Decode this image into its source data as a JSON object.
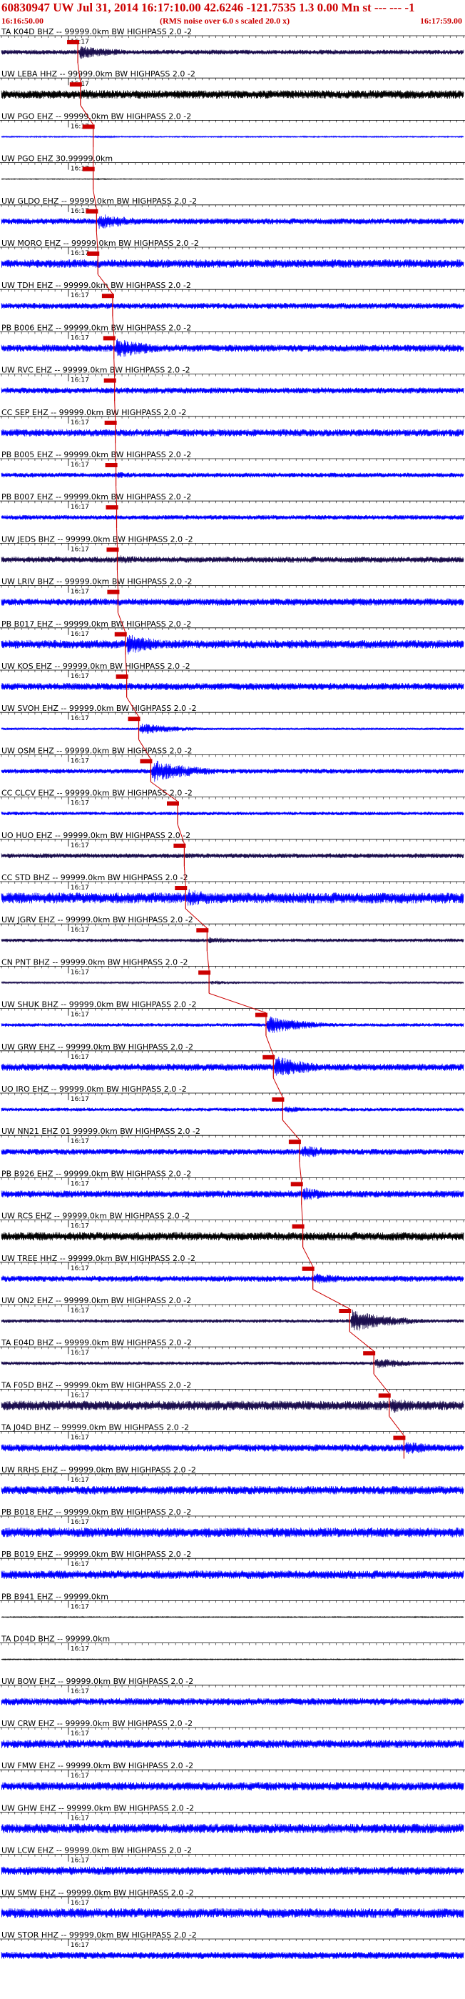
{
  "header": {
    "title": "60830947 UW Jul 31, 2014 16:17:10.00   42.6246 -121.7535  1.3 0.00 Mn st --- --- -1",
    "start_time": "16:16:50.00",
    "note": "(RMS noise over 6.0 s scaled 20.0 x)",
    "end_time": "16:17:59.00"
  },
  "chart_data": {
    "type": "line",
    "title": "60830947 UW Jul 31, 2014 16:17:10.00   42.6246 -121.7535  1.3 0.00 Mn st --- --- -1",
    "x_start": "16:16:50.00",
    "x_end": "16:17:59.00",
    "x_range_s": [
      0,
      69
    ],
    "minute_tick": "16:17",
    "minute_tick_s": 10,
    "pick_marker_color": "#cc0000",
    "colors": {
      "blue": "#0000ff",
      "black": "#000000",
      "navy": "#1a0d4d",
      "red": "#cc0000"
    },
    "traces": [
      {
        "label": "TA K04D BHZ -- 99999.0km BW  HIGHPASS  2.0 -2",
        "color": "navy",
        "pick_s": 11.4,
        "event_s": 11.4,
        "amp": 0.9,
        "burst": 0.6,
        "noise": 0.2
      },
      {
        "label": "UW LEBA HHZ -- 99999.0km BW  HIGHPASS  2.0 -2",
        "color": "black",
        "pick_s": 11.8,
        "event_s": 11.8,
        "amp": 0.8,
        "burst": 0.5,
        "noise": 0.35
      },
      {
        "label": "UW PGO EHZ -- 99999.0km BW  HIGHPASS  2.0 -2",
        "color": "blue",
        "pick_s": 13.7,
        "event_s": 13.7,
        "amp": 0.15,
        "burst": 0.1,
        "noise": 0.05
      },
      {
        "label": "UW PGO EHZ 30.99999.0km",
        "color": "black",
        "pick_s": 13.7,
        "event_s": 13.7,
        "amp": 0.05,
        "burst": 0.05,
        "noise": 0.03
      },
      {
        "label": "UW GLDO EHZ -- 99999.0km BW  HIGHPASS  2.0 -2",
        "color": "blue",
        "pick_s": 14.2,
        "event_s": 14.2,
        "amp": 0.8,
        "burst": 0.7,
        "noise": 0.25
      },
      {
        "label": "UW MORO EHZ -- 99999.0km BW  HIGHPASS  2.0 -2",
        "color": "blue",
        "pick_s": 14.4,
        "event_s": 14.4,
        "amp": 0.8,
        "burst": 0.3,
        "noise": 0.35
      },
      {
        "label": "UW TDH EHZ -- 99999.0km BW  HIGHPASS  2.0 -2",
        "color": "blue",
        "pick_s": 16.6,
        "event_s": 16.6,
        "amp": 0.7,
        "burst": 0.2,
        "noise": 0.25
      },
      {
        "label": "PB B006 EHZ -- 99999.0km BW  HIGHPASS  2.0 -2",
        "color": "blue",
        "pick_s": 16.8,
        "event_s": 16.8,
        "amp": 0.9,
        "burst": 0.9,
        "noise": 0.3
      },
      {
        "label": "UW RVC EHZ -- 99999.0km BW  HIGHPASS  2.0 -2",
        "color": "blue",
        "pick_s": 16.9,
        "event_s": 16.9,
        "amp": 0.6,
        "burst": 0.3,
        "noise": 0.25
      },
      {
        "label": "CC SEP EHZ -- 99999.0km BW  HIGHPASS  2.0 -2",
        "color": "blue",
        "pick_s": 17.0,
        "event_s": 17.0,
        "amp": 0.6,
        "burst": 0.3,
        "noise": 0.3
      },
      {
        "label": "PB B005 EHZ -- 99999.0km BW  HIGHPASS  2.0 -2",
        "color": "blue",
        "pick_s": 17.1,
        "event_s": 17.1,
        "amp": 0.5,
        "burst": 0.3,
        "noise": 0.2
      },
      {
        "label": "PB B007 EHZ -- 99999.0km BW  HIGHPASS  2.0 -2",
        "color": "blue",
        "pick_s": 17.2,
        "event_s": 17.2,
        "amp": 0.4,
        "burst": 0.2,
        "noise": 0.2
      },
      {
        "label": "UW JEDS BHZ -- 99999.0km BW  HIGHPASS  2.0 -2",
        "color": "navy",
        "pick_s": 17.3,
        "event_s": 17.3,
        "amp": 0.6,
        "burst": 0.4,
        "noise": 0.25
      },
      {
        "label": "UW LRIV BHZ -- 99999.0km BW  HIGHPASS  2.0 -2",
        "color": "blue",
        "pick_s": 17.4,
        "event_s": 17.4,
        "amp": 0.6,
        "burst": 0.3,
        "noise": 0.3
      },
      {
        "label": "PB B017 EHZ -- 99999.0km BW  HIGHPASS  2.0 -2",
        "color": "blue",
        "pick_s": 18.5,
        "event_s": 18.5,
        "amp": 0.9,
        "burst": 0.9,
        "noise": 0.35
      },
      {
        "label": "UW KOS EHZ -- 99999.0km BW  HIGHPASS  2.0 -2",
        "color": "blue",
        "pick_s": 18.7,
        "event_s": 18.7,
        "amp": 0.5,
        "burst": 0.3,
        "noise": 0.3
      },
      {
        "label": "UW SVOH EHZ -- 99999.0km BW  HIGHPASS  2.0 -2",
        "color": "blue",
        "pick_s": 20.5,
        "event_s": 20.5,
        "amp": 0.5,
        "burst": 0.5,
        "noise": 0.1
      },
      {
        "label": "UW OSM EHZ -- 99999.0km BW  HIGHPASS  2.0 -2",
        "color": "blue",
        "pick_s": 22.3,
        "event_s": 22.3,
        "amp": 1.0,
        "burst": 1.0,
        "noise": 0.2
      },
      {
        "label": "CC CLCV EHZ -- 99999.0km BW  HIGHPASS  2.0 -2",
        "color": "blue",
        "pick_s": 26.3,
        "event_s": 26.3,
        "amp": 0.4,
        "burst": 0.2,
        "noise": 0.15
      },
      {
        "label": "UO HUO EHZ -- 99999.0km BW  HIGHPASS  2.0 -2",
        "color": "navy",
        "pick_s": 27.3,
        "event_s": 27.3,
        "amp": 0.4,
        "burst": 0.25,
        "noise": 0.2
      },
      {
        "label": "CC STD BHZ -- 99999.0km BW  HIGHPASS  2.0 -2",
        "color": "blue",
        "pick_s": 27.5,
        "event_s": 27.5,
        "amp": 0.8,
        "burst": 0.8,
        "noise": 0.45
      },
      {
        "label": "UW JGRV EHZ -- 99999.0km BW  HIGHPASS  2.0 -2",
        "color": "navy",
        "pick_s": 30.7,
        "event_s": 30.7,
        "amp": 0.5,
        "burst": 0.3,
        "noise": 0.15
      },
      {
        "label": "CN PNT BHZ -- 99999.0km BW  HIGHPASS  2.0 -2",
        "color": "navy",
        "pick_s": 31.0,
        "event_s": 31.0,
        "amp": 0.25,
        "burst": 0.2,
        "noise": 0.08
      },
      {
        "label": "UW SHUK BHZ -- 99999.0km BW  HIGHPASS  2.0 -2",
        "color": "blue",
        "pick_s": 39.5,
        "event_s": 39.5,
        "amp": 0.9,
        "burst": 0.8,
        "noise": 0.15
      },
      {
        "label": "UW GRW EHZ -- 99999.0km BW  HIGHPASS  2.0 -2",
        "color": "blue",
        "pick_s": 40.6,
        "event_s": 40.6,
        "amp": 1.0,
        "burst": 1.0,
        "noise": 0.3
      },
      {
        "label": "UO IRO EHZ -- 99999.0km BW  HIGHPASS  2.0 -2",
        "color": "blue",
        "pick_s": 42.0,
        "event_s": 42.0,
        "amp": 0.4,
        "burst": 0.3,
        "noise": 0.15
      },
      {
        "label": "UW NN21 EHZ 01 99999.0km BW  HIGHPASS  2.0 -2",
        "color": "blue",
        "pick_s": 44.5,
        "event_s": 44.5,
        "amp": 0.7,
        "burst": 0.6,
        "noise": 0.25
      },
      {
        "label": "PB B926 EHZ -- 99999.0km BW  HIGHPASS  2.0 -2",
        "color": "blue",
        "pick_s": 44.8,
        "event_s": 44.8,
        "amp": 0.6,
        "burst": 0.6,
        "noise": 0.3
      },
      {
        "label": "UW RCS EHZ -- 99999.0km BW  HIGHPASS  2.0 -2",
        "color": "black",
        "pick_s": 45.0,
        "event_s": 45.0,
        "amp": 0.4,
        "burst": 0.1,
        "noise": 0.35
      },
      {
        "label": "UW TREE HHZ -- 99999.0km BW  HIGHPASS  2.0 -2",
        "color": "blue",
        "pick_s": 46.5,
        "event_s": 46.5,
        "amp": 0.5,
        "burst": 0.5,
        "noise": 0.25
      },
      {
        "label": "UW ON2 EHZ -- 99999.0km BW  HIGHPASS  2.0 -2",
        "color": "navy",
        "pick_s": 52.0,
        "event_s": 52.0,
        "amp": 1.0,
        "burst": 1.0,
        "noise": 0.15
      },
      {
        "label": "TA E04D BHZ -- 99999.0km BW  HIGHPASS  2.0 -2",
        "color": "navy",
        "pick_s": 55.6,
        "event_s": 55.6,
        "amp": 0.5,
        "burst": 0.5,
        "noise": 0.15
      },
      {
        "label": "TA F05D BHZ -- 99999.0km BW  HIGHPASS  2.0 -2",
        "color": "navy",
        "pick_s": 57.9,
        "event_s": 57.9,
        "amp": 0.8,
        "burst": 0.7,
        "noise": 0.4
      },
      {
        "label": "TA J04D BHZ -- 99999.0km BW  HIGHPASS  2.0 -2",
        "color": "blue",
        "pick_s": 60.1,
        "event_s": 60.1,
        "amp": 0.7,
        "burst": 0.6,
        "noise": 0.3
      },
      {
        "label": "UW RRHS EHZ -- 99999.0km BW  HIGHPASS  2.0 -2",
        "color": "blue",
        "pick_s": null,
        "event_s": null,
        "amp": 0.35,
        "burst": 0,
        "noise": 0.35
      },
      {
        "label": "PB B018 EHZ -- 99999.0km BW  HIGHPASS  2.0 -2",
        "color": "blue",
        "pick_s": null,
        "event_s": null,
        "amp": 0.4,
        "burst": 0,
        "noise": 0.4
      },
      {
        "label": "PB B019 EHZ -- 99999.0km BW  HIGHPASS  2.0 -2",
        "color": "blue",
        "pick_s": null,
        "event_s": null,
        "amp": 0.35,
        "burst": 0,
        "noise": 0.35
      },
      {
        "label": "PB B941 EHZ -- 99999.0km",
        "color": "black",
        "pick_s": null,
        "event_s": null,
        "amp": 0.04,
        "burst": 0,
        "noise": 0.04
      },
      {
        "label": "TA D04D BHZ -- 99999.0km",
        "color": "black",
        "pick_s": null,
        "event_s": null,
        "amp": 0.04,
        "burst": 0,
        "noise": 0.04
      },
      {
        "label": "UW BOW EHZ -- 99999.0km BW  HIGHPASS  2.0 -2",
        "color": "blue",
        "pick_s": null,
        "event_s": null,
        "amp": 0.3,
        "burst": 0,
        "noise": 0.3
      },
      {
        "label": "UW CRW EHZ -- 99999.0km BW  HIGHPASS  2.0 -2",
        "color": "blue",
        "pick_s": null,
        "event_s": null,
        "amp": 0.35,
        "burst": 0,
        "noise": 0.35
      },
      {
        "label": "UW FMW EHZ -- 99999.0km BW  HIGHPASS  2.0 -2",
        "color": "blue",
        "pick_s": null,
        "event_s": null,
        "amp": 0.35,
        "burst": 0,
        "noise": 0.35
      },
      {
        "label": "UW GHW EHZ -- 99999.0km BW  HIGHPASS  2.0 -2",
        "color": "blue",
        "pick_s": null,
        "event_s": null,
        "amp": 0.4,
        "burst": 0,
        "noise": 0.4
      },
      {
        "label": "UW LCW EHZ -- 99999.0km BW  HIGHPASS  2.0 -2",
        "color": "blue",
        "pick_s": null,
        "event_s": null,
        "amp": 0.35,
        "burst": 0,
        "noise": 0.35
      },
      {
        "label": "UW SMW EHZ -- 99999.0km BW  HIGHPASS  2.0 -2",
        "color": "blue",
        "pick_s": null,
        "event_s": null,
        "amp": 0.4,
        "burst": 0,
        "noise": 0.4
      },
      {
        "label": "UW STOR HHZ -- 99999.0km BW  HIGHPASS  2.0 -2",
        "color": "blue",
        "pick_s": null,
        "event_s": null,
        "amp": 0.3,
        "burst": 0,
        "noise": 0.3
      }
    ]
  }
}
